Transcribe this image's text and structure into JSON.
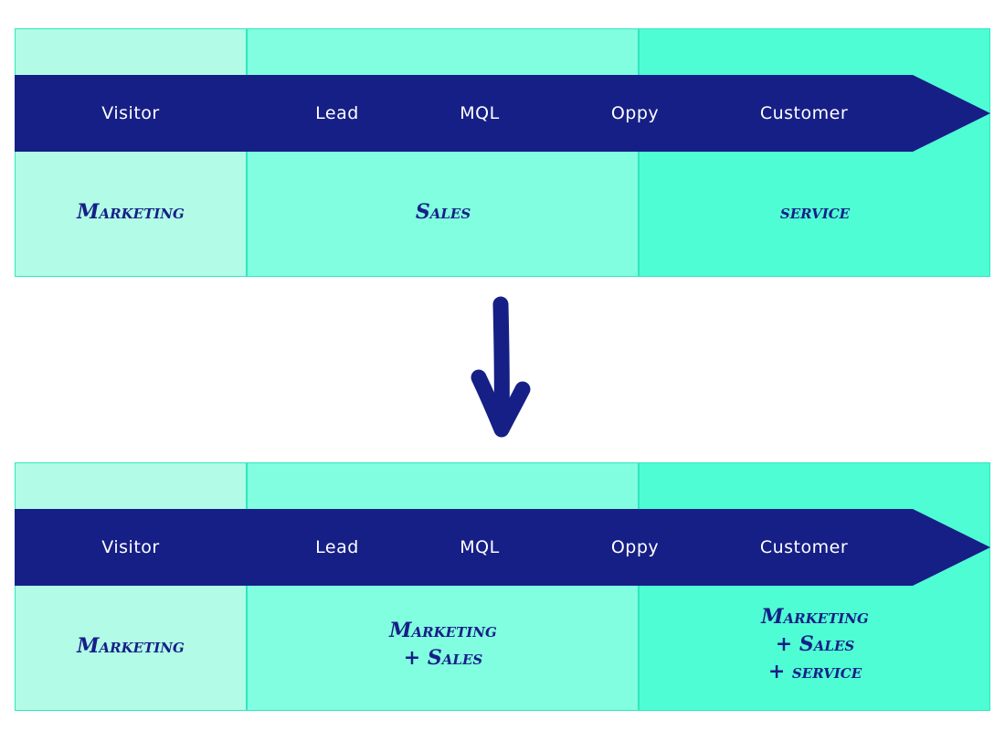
{
  "colors": {
    "band": "#161f86",
    "marketing_column": "#b1fbe7",
    "sales_column": "#81fde0",
    "service_column": "#4ffdd4",
    "border": "#2ee8c0",
    "team_text": "#161f86",
    "stage_text": "#ffffff"
  },
  "stages": [
    "Visitor",
    "Lead",
    "MQL",
    "Oppy",
    "Customer"
  ],
  "before": {
    "teams": [
      {
        "lines": [
          "Marketing"
        ]
      },
      {
        "lines": [
          "Sales"
        ]
      },
      {
        "lines": [
          "service"
        ]
      }
    ]
  },
  "transition": {
    "icon": "hand-drawn-down-arrow-icon"
  },
  "after": {
    "teams": [
      {
        "lines": [
          "Marketing"
        ]
      },
      {
        "lines": [
          "Marketing",
          "+ Sales"
        ]
      },
      {
        "lines": [
          "Marketing",
          "+ Sales",
          "+ service"
        ]
      }
    ]
  }
}
